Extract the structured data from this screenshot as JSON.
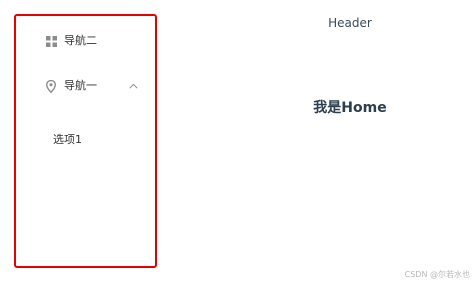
{
  "sidebar": {
    "items": [
      {
        "label": "导航二",
        "icon": "grid-icon"
      },
      {
        "label": "导航一",
        "icon": "location-pin-icon",
        "expanded": true
      }
    ],
    "submenu": [
      {
        "label": "选项1"
      }
    ]
  },
  "header": {
    "title": "Header"
  },
  "main": {
    "title": "我是Home"
  },
  "watermark": "CSDN @尔若水也",
  "colors": {
    "highlight_border": "#e60000",
    "text": "#303133",
    "icon": "#8c8c8c"
  }
}
